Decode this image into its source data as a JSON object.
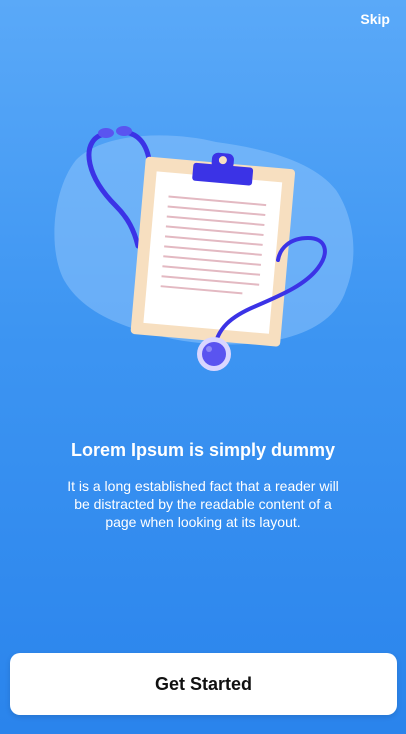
{
  "header": {
    "skip_label": "Skip"
  },
  "onboarding": {
    "illustration": "clipboard-stethoscope-illustration",
    "title": "Lorem Ipsum is simply dummy",
    "description": "It is a long established fact that a reader will be distracted by the readable content of a page when looking at its layout."
  },
  "footer": {
    "cta_label": "Get Started"
  },
  "colors": {
    "background_top": "#5aa9f8",
    "background_bottom": "#2a84ec",
    "accent": "#3b33e6",
    "button_bg": "#ffffff",
    "button_text": "#111111"
  }
}
